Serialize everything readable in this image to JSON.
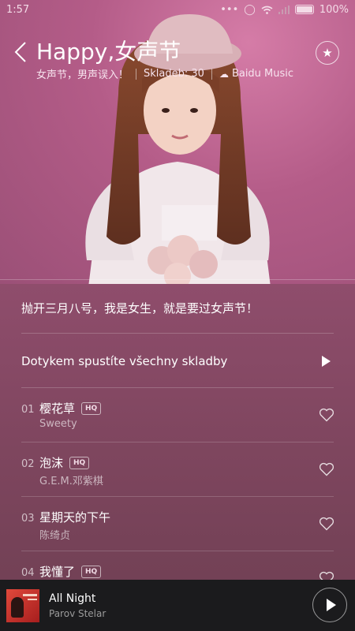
{
  "status_bar": {
    "time": "1:57",
    "battery": "100%",
    "icons": [
      "dots-icon",
      "circle-icon",
      "wifi-icon",
      "signal-icon",
      "battery-icon"
    ]
  },
  "header": {
    "title": "Happy,女声节",
    "subtitle": "女声节，男声误入！",
    "track_count": "Skladeb: 30",
    "source": "Baidu Music",
    "back_icon": "chevron-left-icon",
    "favorite_icon": "star-icon"
  },
  "description": "抛开三月八号，我是女生，就是要过女声节！",
  "play_all": {
    "label": "Dotykem spustíte všechny skladby",
    "icon": "play-icon"
  },
  "songs": [
    {
      "num": "01",
      "title": "樱花草",
      "hq": "HQ",
      "artist": "Sweety"
    },
    {
      "num": "02",
      "title": "泡沫",
      "hq": "HQ",
      "artist": "G.E.M.邓紫棋"
    },
    {
      "num": "03",
      "title": "星期天的下午",
      "hq": "",
      "artist": "陈绮贞"
    },
    {
      "num": "04",
      "title": "我懂了",
      "hq": "HQ",
      "artist": ""
    }
  ],
  "now_playing": {
    "title": "All Night",
    "artist": "Parov Stelar",
    "cover_text": "PAROV STELAR",
    "play_icon": "play-icon"
  },
  "colors": {
    "background": "#8f4d6c",
    "hero": "#b45c88",
    "player_bar": "#1b1b1d"
  }
}
